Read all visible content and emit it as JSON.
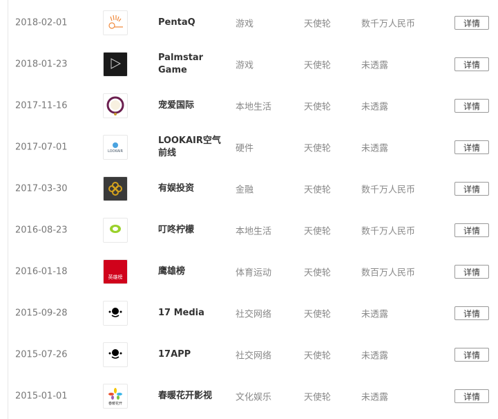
{
  "detail_label": "详情",
  "rows": [
    {
      "date": "2018-02-01",
      "name": "PentaQ",
      "category": "游戏",
      "round": "天使轮",
      "amount": "数千万人民币",
      "logo_style": "pentaq"
    },
    {
      "date": "2018-01-23",
      "name": "Palmstar Game",
      "category": "游戏",
      "round": "天使轮",
      "amount": "未透露",
      "logo_style": "palmstar"
    },
    {
      "date": "2017-11-16",
      "name": "宠爱国际",
      "category": "本地生活",
      "round": "天使轮",
      "amount": "未透露",
      "logo_style": "pet"
    },
    {
      "date": "2017-07-01",
      "name": "LOOKAIR空气前线",
      "category": "硬件",
      "round": "天使轮",
      "amount": "未透露",
      "logo_style": "lookair"
    },
    {
      "date": "2017-03-30",
      "name": "有娱投资",
      "category": "金融",
      "round": "天使轮",
      "amount": "数千万人民币",
      "logo_style": "youyu"
    },
    {
      "date": "2016-08-23",
      "name": "叮咚柠檬",
      "category": "本地生活",
      "round": "天使轮",
      "amount": "数千万人民币",
      "logo_style": "lemon"
    },
    {
      "date": "2016-01-18",
      "name": "鹰雄榜",
      "category": "体育运动",
      "round": "天使轮",
      "amount": "数百万人民币",
      "logo_style": "hero"
    },
    {
      "date": "2015-09-28",
      "name": "17 Media",
      "category": "社交网络",
      "round": "天使轮",
      "amount": "未透露",
      "logo_style": "17"
    },
    {
      "date": "2015-07-26",
      "name": "17APP",
      "category": "社交网络",
      "round": "天使轮",
      "amount": "未透露",
      "logo_style": "17"
    },
    {
      "date": "2015-01-01",
      "name": "春暖花开影视",
      "category": "文化娱乐",
      "round": "天使轮",
      "amount": "未透露",
      "logo_style": "flower"
    }
  ]
}
